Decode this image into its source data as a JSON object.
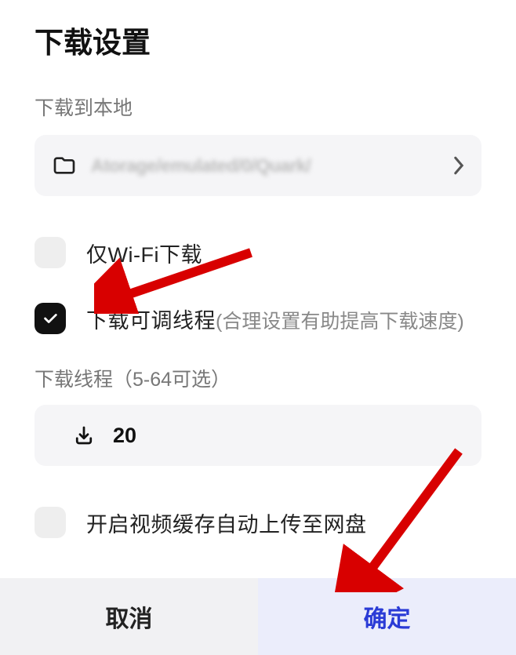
{
  "title": "下载设置",
  "download_to": {
    "label": "下载到本地",
    "path_display": "Atorage/emulated/0/Quark/"
  },
  "options": {
    "wifi_only": {
      "label": "仅Wi-Fi下载",
      "checked": false
    },
    "adjustable_threads": {
      "label": "下载可调线程",
      "hint": "(合理设置有助提高下载速度)",
      "checked": true
    },
    "auto_upload": {
      "label": "开启视频缓存自动上传至网盘",
      "checked": false
    }
  },
  "threads": {
    "label": "下载线程（5-64可选）",
    "value": "20"
  },
  "buttons": {
    "cancel": "取消",
    "ok": "确定"
  }
}
